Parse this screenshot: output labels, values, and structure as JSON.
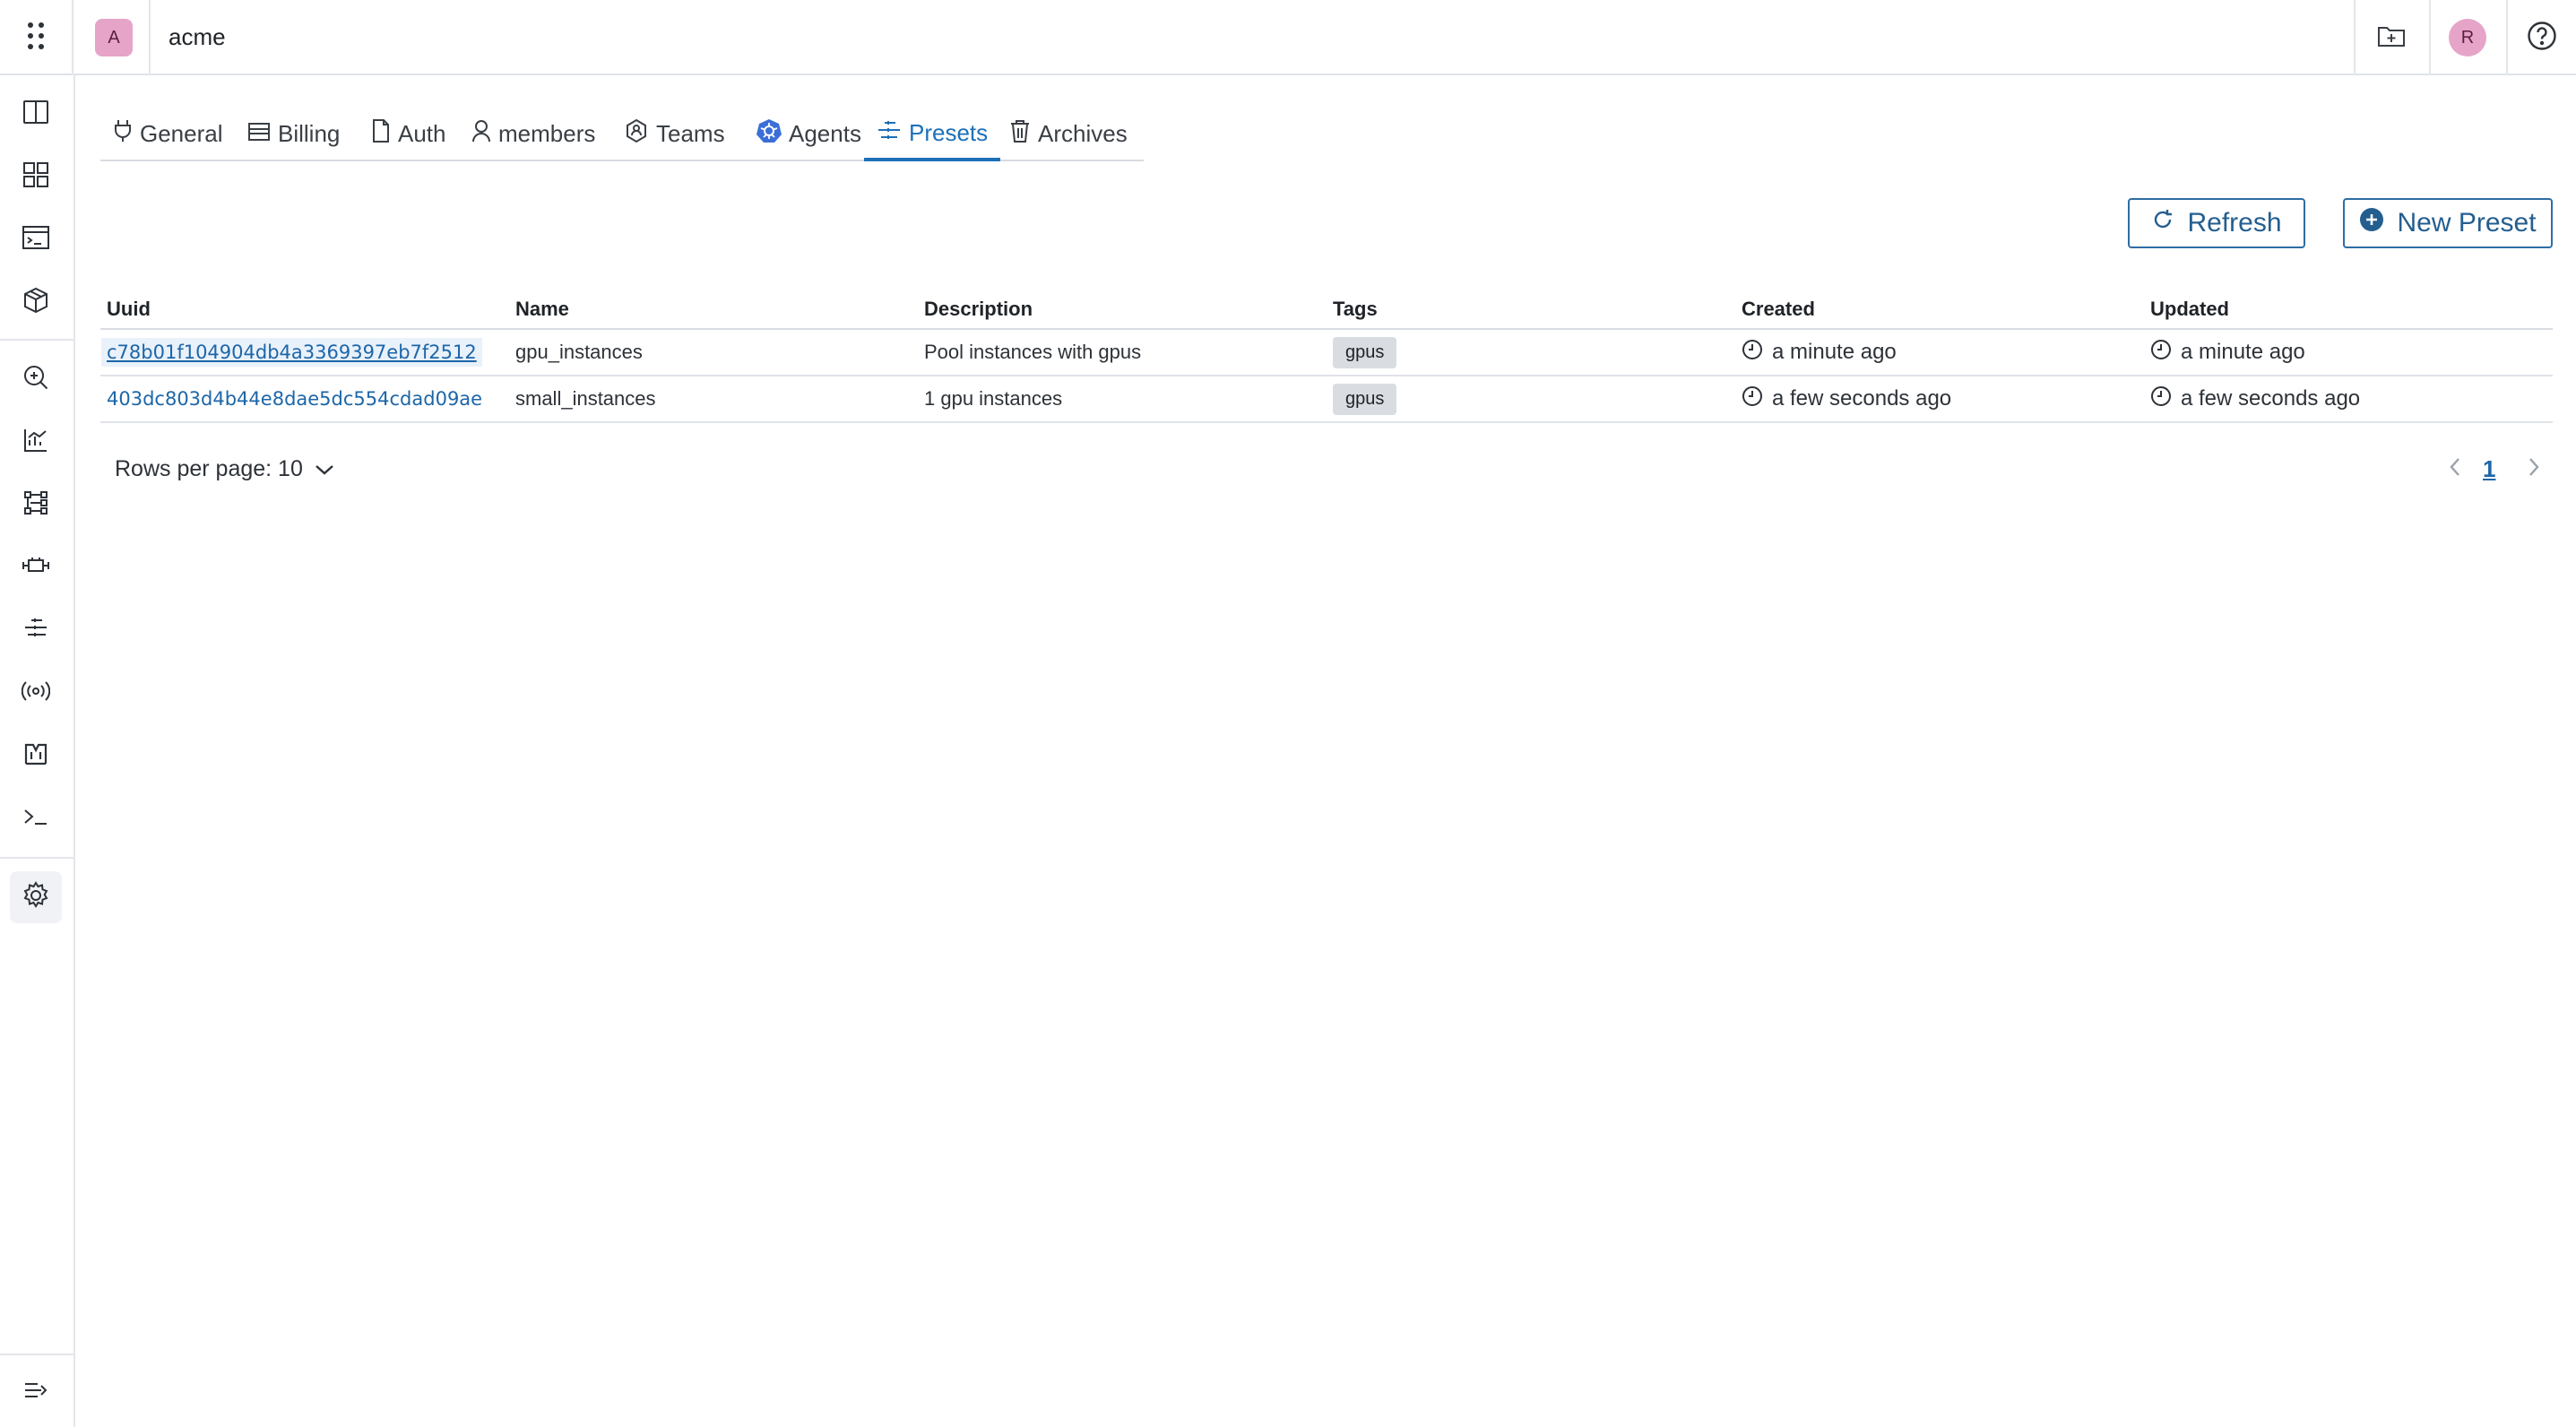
{
  "header": {
    "org_initial": "A",
    "org_name": "acme",
    "user_initial": "R",
    "icons": [
      "apps-grid-icon",
      "folder-add-icon",
      "help-circle-icon"
    ]
  },
  "sidebar": {
    "items": [
      {
        "name": "sidebar-item-layout",
        "icon": "book-open-icon"
      },
      {
        "name": "sidebar-item-dashboards",
        "icon": "grid-icon"
      },
      {
        "name": "sidebar-item-runs",
        "icon": "terminal-window-icon"
      },
      {
        "name": "sidebar-item-components",
        "icon": "cube-icon"
      },
      {
        "name": "sidebar-item-search",
        "icon": "search-zoom-icon"
      },
      {
        "name": "sidebar-item-analytics",
        "icon": "chart-line-icon"
      },
      {
        "name": "sidebar-item-dag",
        "icon": "dag-icon"
      },
      {
        "name": "sidebar-item-connections",
        "icon": "connection-icon"
      },
      {
        "name": "sidebar-item-presets",
        "icon": "presets-icon"
      },
      {
        "name": "sidebar-item-agents",
        "icon": "broadcast-icon"
      },
      {
        "name": "sidebar-item-registry",
        "icon": "registry-icon"
      },
      {
        "name": "sidebar-item-console",
        "icon": "console-icon"
      },
      {
        "name": "sidebar-item-settings",
        "icon": "gear-icon",
        "active": true
      }
    ],
    "collapse_icon": "expand-sidebar-icon"
  },
  "tabs": [
    {
      "label": "General",
      "icon": "plug-icon"
    },
    {
      "label": "Billing",
      "icon": "credit-card-icon"
    },
    {
      "label": "Auth",
      "icon": "document-icon"
    },
    {
      "label": "members",
      "icon": "user-icon"
    },
    {
      "label": "Teams",
      "icon": "team-icon"
    },
    {
      "label": "Agents",
      "icon": "kubernetes-icon"
    },
    {
      "label": "Presets",
      "icon": "presets-icon",
      "active": true
    },
    {
      "label": "Archives",
      "icon": "trash-icon"
    }
  ],
  "actions": {
    "refresh_label": "Refresh",
    "new_preset_label": "New Preset"
  },
  "table": {
    "columns": [
      "Uuid",
      "Name",
      "Description",
      "Tags",
      "Created",
      "Updated"
    ],
    "rows": [
      {
        "uuid": "c78b01f104904db4a3369397eb7f2512",
        "name": "gpu_instances",
        "description": "Pool instances with gpus",
        "tag": "gpus",
        "created": "a minute ago",
        "updated": "a minute ago"
      },
      {
        "uuid": "403dc803d4b44e8dae5dc554cdad09ae",
        "name": "small_instances",
        "description": "1 gpu instances",
        "tag": "gpus",
        "created": "a few seconds ago",
        "updated": "a few seconds ago"
      }
    ]
  },
  "pagination": {
    "rows_per_page_label": "Rows per page: 10",
    "current_page": "1"
  },
  "colors": {
    "accent": "#1d70b8",
    "avatar": "#e6a4c8",
    "tag_bg": "#d9dde2"
  }
}
